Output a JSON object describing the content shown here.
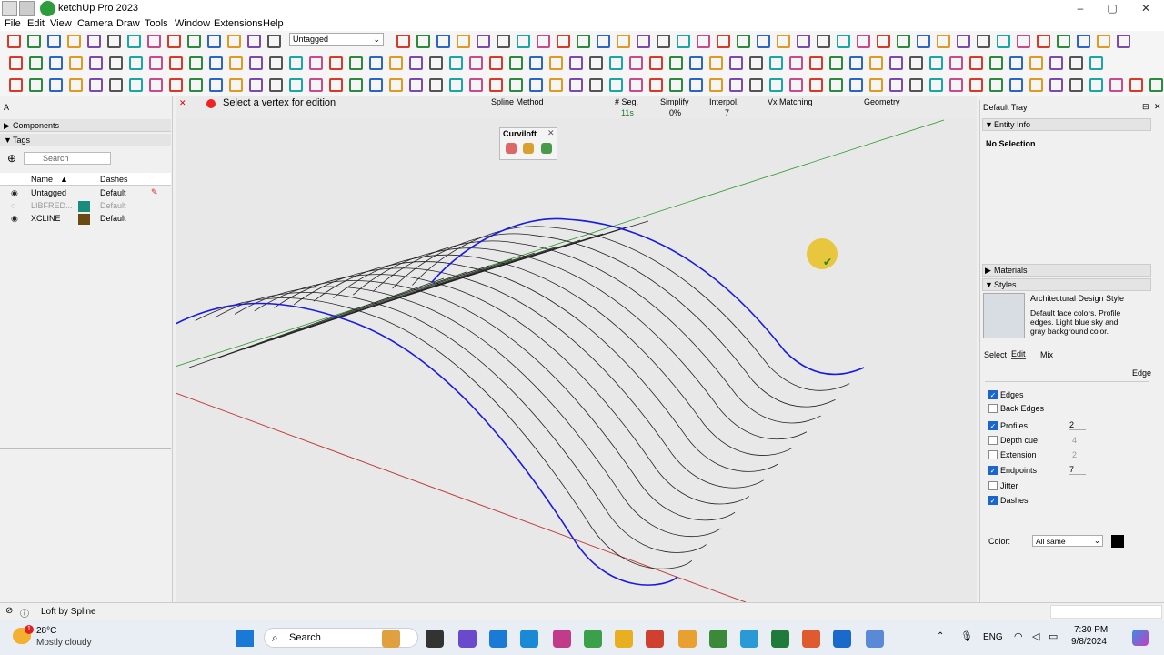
{
  "app": {
    "title": "ketchUp Pro 2023"
  },
  "menu": [
    "File",
    "Edit",
    "View",
    "Camera",
    "Draw",
    "Tools",
    "Window",
    "Extensions",
    "Help"
  ],
  "toolbar": {
    "tag_select": "Untagged"
  },
  "viewport": {
    "status_msg": "Select a vertex for edition",
    "labels": {
      "spline_method": "Spline Method",
      "seg": "# Seg.",
      "seg_val": "11s",
      "simplify": "Simplify",
      "simplify_val": "0%",
      "interpol": "Interpol.",
      "interpol_val": "7",
      "vx_matching": "Vx Matching",
      "geometry": "Geometry"
    },
    "curviloft": "Curviloft"
  },
  "left": {
    "label_a": "A",
    "components": "Components",
    "tags": "Tags",
    "search_placeholder": "Search",
    "col_name": "Name",
    "col_dashes": "Dashes",
    "tags_list": [
      {
        "name": "Untagged",
        "dashes": "Default",
        "color": "",
        "visible": true
      },
      {
        "name": "LIBFRED...",
        "dashes": "Default",
        "color": "#1a8c7e",
        "visible": false
      },
      {
        "name": "XCLINE",
        "dashes": "Default",
        "color": "#6b4a12",
        "visible": true
      }
    ]
  },
  "right": {
    "tray": "Default Tray",
    "entity_info": "Entity Info",
    "no_selection": "No Selection",
    "materials": "Materials",
    "styles": "Styles",
    "style_name": "Architectural Design Style",
    "style_desc": "Default face colors. Profile edges. Light blue sky and gray background color.",
    "tabs": {
      "select": "Select",
      "edit": "Edit",
      "mix": "Mix"
    },
    "edge_label": "Edge",
    "options": {
      "edges": "Edges",
      "back_edges": "Back Edges",
      "profiles": "Profiles",
      "profiles_val": "2",
      "depth_cue": "Depth cue",
      "depth_val": "4",
      "extension": "Extension",
      "extension_val": "2",
      "endpoints": "Endpoints",
      "endpoints_val": "7",
      "jitter": "Jitter",
      "dashes": "Dashes"
    },
    "color_label": "Color:",
    "color_value": "All same"
  },
  "status": {
    "text": "Loft by Spline"
  },
  "taskbar": {
    "weather_temp": "28°C",
    "weather_desc": "Mostly cloudy",
    "search": "Search",
    "lang": "ENG",
    "time": "7:30 PM",
    "date": "9/8/2024",
    "badge": "1"
  }
}
